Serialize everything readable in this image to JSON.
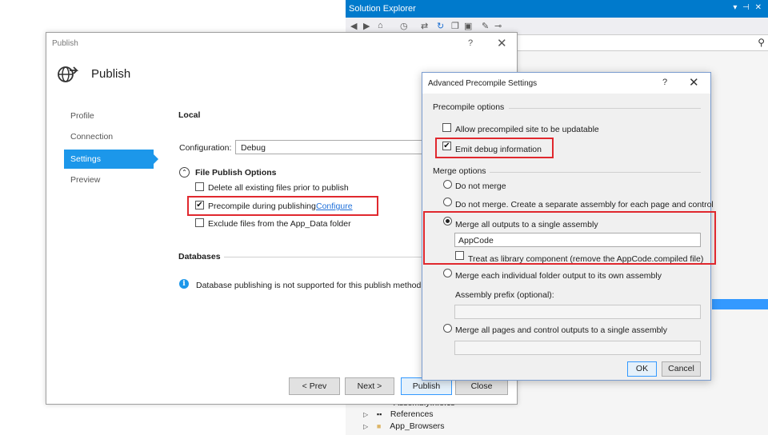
{
  "solution_explorer": {
    "title": "Solution Explorer",
    "window_controls": "▾ ⊣ ✕",
    "tree": [
      {
        "label": "AssemblyInfo.cs"
      },
      {
        "label": "References"
      },
      {
        "label": "App_Browsers"
      }
    ]
  },
  "publish": {
    "window_title": "Publish",
    "help": "?",
    "close": "✕",
    "header_title": "Publish",
    "nav": [
      {
        "label": "Profile"
      },
      {
        "label": "Connection"
      },
      {
        "label": "Settings"
      },
      {
        "label": "Preview"
      }
    ],
    "active_nav": "Settings",
    "section_local": "Local",
    "configuration_label": "Configuration:",
    "configuration_value": "Debug",
    "file_publish_options": "File Publish Options",
    "options": {
      "delete_existing": "Delete all existing files prior to publish",
      "precompile": "Precompile during publishing",
      "configure_link": "Configure",
      "exclude_app_data": "Exclude files from the App_Data folder"
    },
    "section_databases": "Databases",
    "db_info": "Database publishing is not supported for this publish method.",
    "buttons": {
      "prev": "< Prev",
      "next": "Next >",
      "publish": "Publish",
      "close": "Close"
    }
  },
  "advanced": {
    "title": "Advanced Precompile Settings",
    "help": "?",
    "close": "✕",
    "precompile_options_label": "Precompile options",
    "allow_updatable": "Allow precompiled site to be updatable",
    "emit_debug": "Emit debug information",
    "merge_options_label": "Merge options",
    "radios": {
      "do_not_merge": "Do not merge",
      "do_not_merge_separate": "Do not merge. Create a separate assembly for each page and control",
      "merge_all_single": "Merge all outputs to a single assembly",
      "merge_each_folder": "Merge each individual folder output to its own assembly",
      "merge_pages_controls": "Merge all pages and control outputs to a single assembly"
    },
    "single_assembly_name": "AppCode",
    "treat_as_library": "Treat as library component (remove the AppCode.compiled file)",
    "assembly_prefix_label": "Assembly prefix (optional):",
    "buttons": {
      "ok": "OK",
      "cancel": "Cancel"
    }
  }
}
